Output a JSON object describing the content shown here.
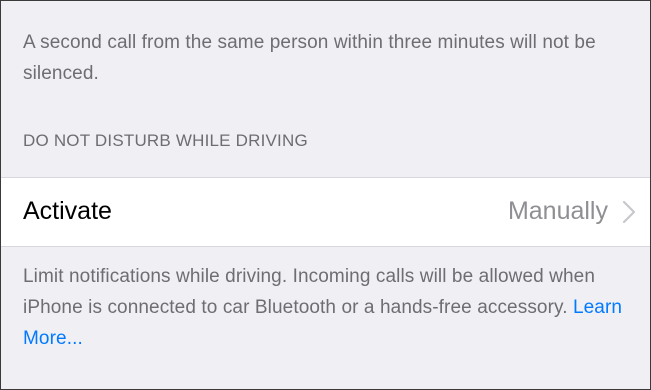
{
  "dnd": {
    "repeated_calls_note": "A second call from the same person within three minutes will not be silenced.",
    "driving_section_header": "DO NOT DISTURB WHILE DRIVING",
    "activate_row": {
      "label": "Activate",
      "value": "Manually",
      "chevron_icon": "chevron-right-icon"
    },
    "driving_note": "Limit notifications while driving. Incoming calls will be allowed when iPhone is connected to car Bluetooth or a hands-free accessory.",
    "learn_more_link": "Learn More..."
  },
  "colors": {
    "background": "#efeff4",
    "cell_background": "#ffffff",
    "secondary_text": "#6d6d72",
    "value_text": "#8e8e93",
    "link": "#007aff",
    "chevron": "#c7c7cc"
  }
}
